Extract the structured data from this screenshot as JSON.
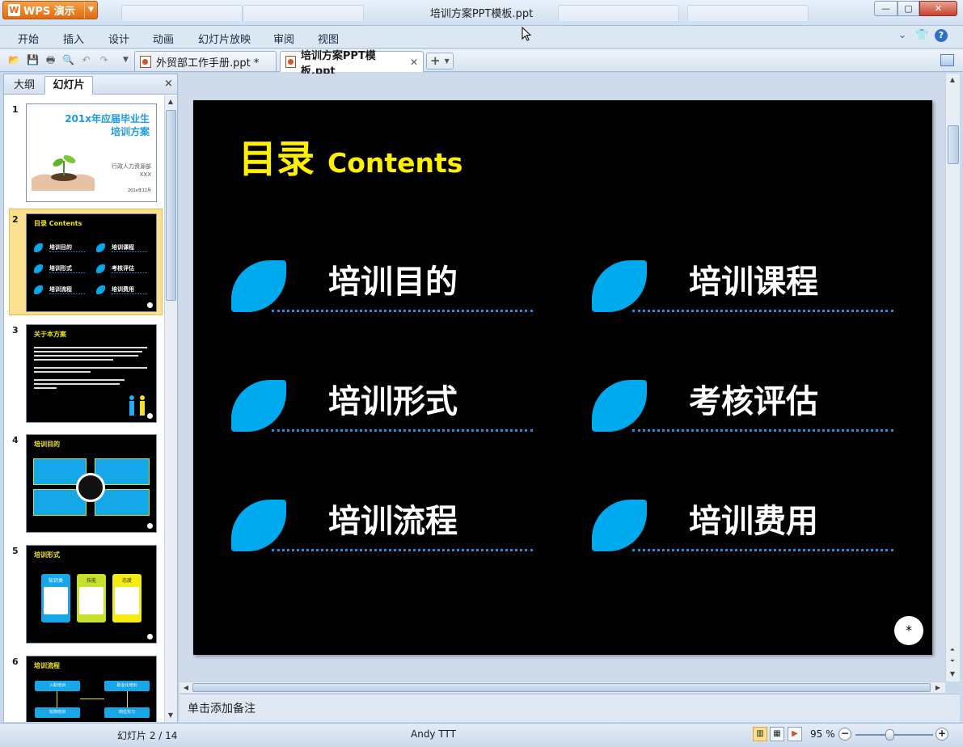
{
  "app": {
    "name": "WPS 演示",
    "window_title": "培训方案PPT模板.ppt"
  },
  "menu": [
    "开始",
    "插入",
    "设计",
    "动画",
    "幻灯片放映",
    "审阅",
    "视图"
  ],
  "tabs": [
    {
      "label": "外贸部工作手册.ppt *",
      "active": false
    },
    {
      "label": "培训方案PPT模板.ppt",
      "active": true
    }
  ],
  "left_pane": {
    "tab_outline": "大纲",
    "tab_slides": "幻灯片",
    "close": "×"
  },
  "thumbnails": [
    {
      "num": "1",
      "title_line1": "201x年应届毕业生",
      "title_line2": "培训方案",
      "dept": "行政人力资源部",
      "name": "XXX",
      "date": "201x年12月"
    },
    {
      "num": "2",
      "title": "目录 Contents",
      "items": [
        "培训目的",
        "培训课程",
        "培训形式",
        "考核评估",
        "培训流程",
        "培训费用"
      ]
    },
    {
      "num": "3",
      "title": "关于本方案"
    },
    {
      "num": "4",
      "title": "培训目的"
    },
    {
      "num": "5",
      "title": "培训形式",
      "boxes": [
        "知识类",
        "技能",
        "态度"
      ]
    },
    {
      "num": "6",
      "title": "培训流程",
      "boxes": [
        "入职培训",
        "职业化培训",
        "轮岗培训",
        "岗位实习"
      ]
    }
  ],
  "slide": {
    "title_zh": "目录",
    "title_en": "Contents",
    "items": [
      "培训目的",
      "培训课程",
      "培训形式",
      "考核评估",
      "培训流程",
      "培训费用"
    ],
    "badge": "*"
  },
  "notes_placeholder": "单击添加备注",
  "status": {
    "slide_indicator": "幻灯片 2 / 14",
    "author": "Andy TTT",
    "zoom": "95 %"
  },
  "colors": {
    "accent_blue": "#00aaee",
    "title_yellow": "#ffef00",
    "slide_bg": "#000000"
  }
}
